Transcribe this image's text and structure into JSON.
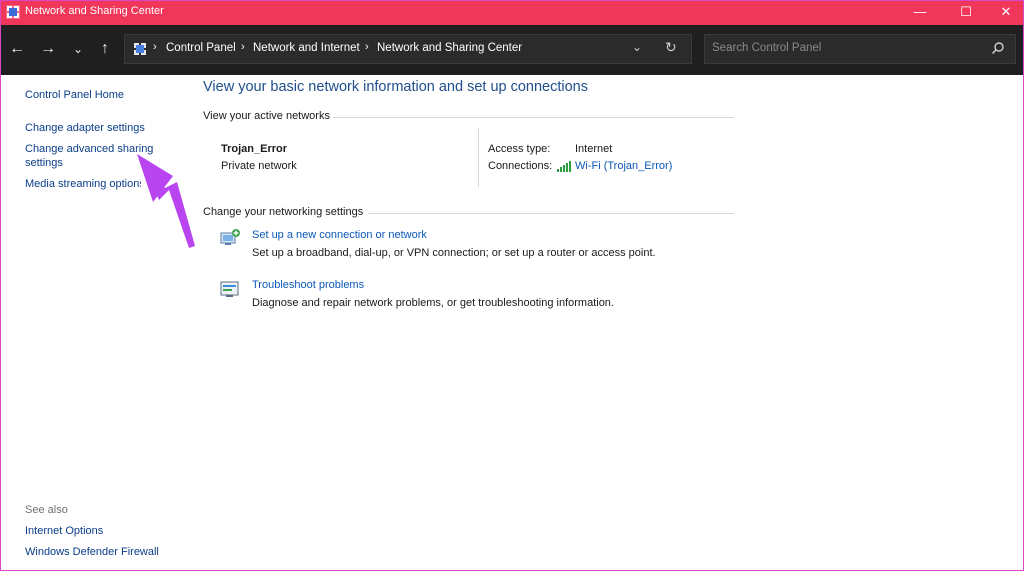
{
  "window": {
    "title": "Network and Sharing Center",
    "controls": {
      "minimize": "—",
      "maximize": "☐",
      "close": "✕"
    }
  },
  "addressbar": {
    "breadcrumbs": [
      "Control Panel",
      "Network and Internet",
      "Network and Sharing Center"
    ],
    "search_placeholder": "Search Control Panel"
  },
  "sidebar": {
    "home": "Control Panel Home",
    "links": [
      "Change adapter settings",
      "Change advanced sharing",
      "settings",
      "Media streaming options"
    ],
    "see_also_label": "See also",
    "see_also": [
      "Internet Options",
      "Windows Defender Firewall"
    ]
  },
  "main": {
    "title": "View your basic network information and set up connections",
    "active_networks_header": "View your active networks",
    "network": {
      "name": "Trojan_Error",
      "type": "Private network",
      "access_type_label": "Access type:",
      "access_type_value": "Internet",
      "connections_label": "Connections:",
      "connections_value": "Wi-Fi (Trojan_Error)"
    },
    "settings_header": "Change your networking settings",
    "tasks": [
      {
        "title": "Set up a new connection or network",
        "description": "Set up a broadband, dial-up, or VPN connection; or set up a router or access point."
      },
      {
        "title": "Troubleshoot problems",
        "description": "Diagnose and repair network problems, or get troubleshooting information."
      }
    ]
  },
  "colors": {
    "titlebar": "#f0375a",
    "addressbar": "#1f1f1f",
    "link": "#0b4fa3",
    "annotation_arrow": "#b845f0"
  }
}
